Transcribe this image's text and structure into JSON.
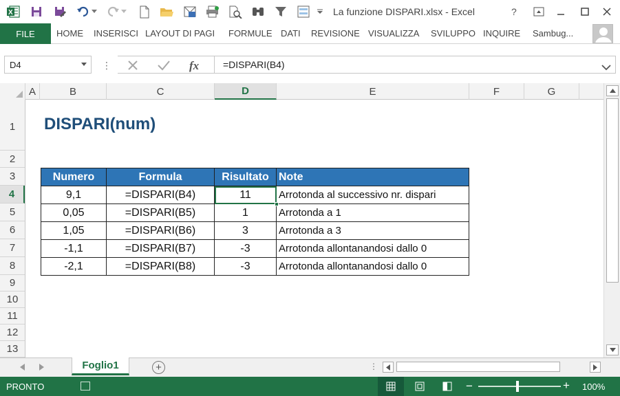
{
  "window": {
    "title": "La funzione DISPARI.xlsx - Excel"
  },
  "ribbon": {
    "file_label": "FILE",
    "tabs": [
      "HOME",
      "INSERISCI",
      "LAYOUT DI PAGI",
      "FORMULE",
      "DATI",
      "REVISIONE",
      "VISUALIZZA",
      "SVILUPPO",
      "INQUIRE"
    ],
    "account": "Sambug..."
  },
  "formula_bar": {
    "name_box": "D4",
    "separator": "⋮",
    "formula": "=DISPARI(B4)"
  },
  "grid": {
    "columns": [
      "A",
      "B",
      "C",
      "D",
      "E",
      "F",
      "G"
    ],
    "selected_column": "D",
    "rows": [
      "1",
      "2",
      "3",
      "4",
      "5",
      "6",
      "7",
      "8",
      "9",
      "10",
      "11",
      "12",
      "13"
    ],
    "selected_row": "4"
  },
  "sheet": {
    "title": "DISPARI(num)",
    "table": {
      "headers": [
        "Numero",
        "Formula",
        "Risultato",
        "Note"
      ],
      "rows": [
        [
          "9,1",
          "=DISPARI(B4)",
          "11",
          "Arrotonda al successivo nr. dispari"
        ],
        [
          "0,05",
          "=DISPARI(B5)",
          "1",
          "Arrotonda a 1"
        ],
        [
          "1,05",
          "=DISPARI(B6)",
          "3",
          "Arrotonda a 3"
        ],
        [
          "-1,1",
          "=DISPARI(B7)",
          "-3",
          "Arrotonda allontanandosi dallo 0"
        ],
        [
          "-2,1",
          "=DISPARI(B8)",
          "-3",
          "Arrotonda allontanandosi dallo 0"
        ]
      ]
    }
  },
  "tabs_bar": {
    "sheet_tab": "Foglio1",
    "add_symbol": "+",
    "dots": "⋮"
  },
  "status": {
    "text": "PRONTO",
    "zoom_level": "100%",
    "zoom_fraction": 0.46
  },
  "colors": {
    "excel_green": "#217346",
    "header_blue": "#2e75b6",
    "title_blue": "#1f4e79"
  }
}
